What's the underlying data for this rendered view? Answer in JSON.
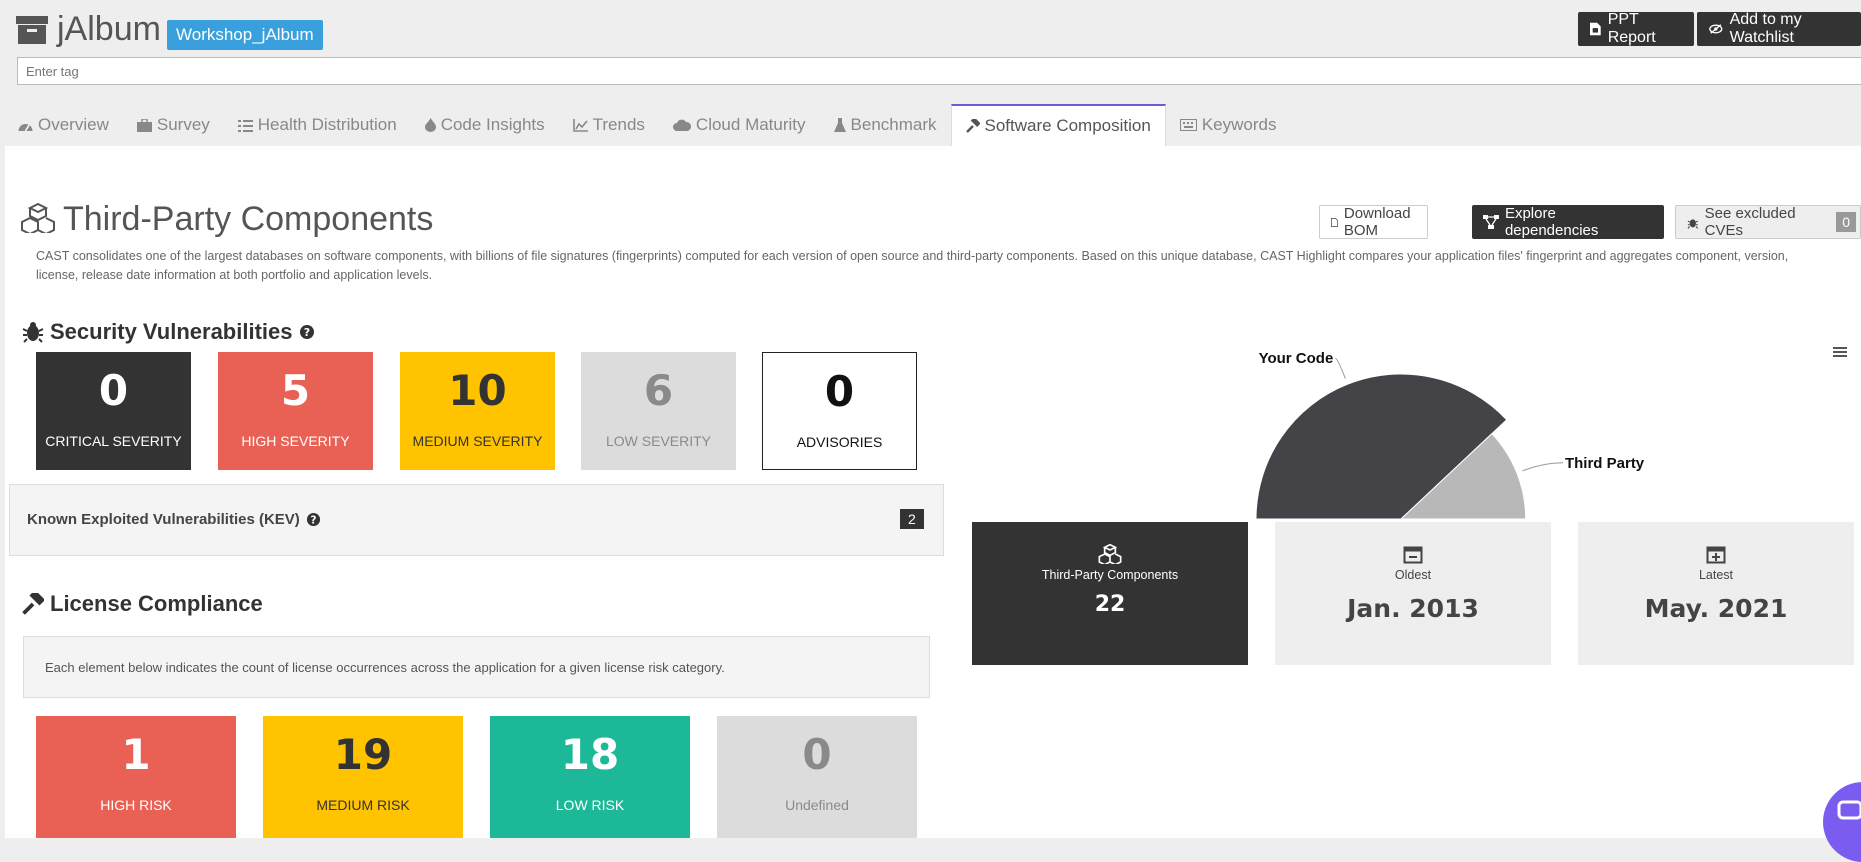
{
  "header": {
    "app_title": "jAlbum",
    "app_tag": "Workshop_jAlbum",
    "ppt_report": "PPT Report",
    "watchlist": "Add to my Watchlist",
    "tag_placeholder": "Enter tag"
  },
  "tabs": [
    {
      "label": "Overview",
      "icon": "dashboard-icon"
    },
    {
      "label": "Survey",
      "icon": "briefcase-icon"
    },
    {
      "label": "Health Distribution",
      "icon": "tasks-icon"
    },
    {
      "label": "Code Insights",
      "icon": "fire-icon"
    },
    {
      "label": "Trends",
      "icon": "line-chart-icon"
    },
    {
      "label": "Cloud Maturity",
      "icon": "cloud-icon"
    },
    {
      "label": "Benchmark",
      "icon": "flask-icon"
    },
    {
      "label": "Software Composition",
      "icon": "gavel-icon",
      "active": true
    },
    {
      "label": "Keywords",
      "icon": "keyboard-icon"
    }
  ],
  "section": {
    "title": "Third-Party Components",
    "description": "CAST consolidates one of the largest databases on software components, with billions of file signatures (fingerprints) computed for each version of open source and third-party components. Based on this unique database, CAST Highlight compares your application files' fingerprint and aggregates component, version, license, release date information at both portfolio and application levels.",
    "download_bom": "Download BOM",
    "explore_dependencies": "Explore dependencies",
    "excluded_cves": "See excluded CVEs",
    "excluded_cves_count": "0"
  },
  "security": {
    "title": "Security Vulnerabilities",
    "boxes": [
      {
        "value": "0",
        "label": "CRITICAL SEVERITY",
        "bg": "#333333",
        "fg": "#ffffff"
      },
      {
        "value": "5",
        "label": "HIGH SEVERITY",
        "bg": "#e96154",
        "fg": "#ffffff"
      },
      {
        "value": "10",
        "label": "MEDIUM SEVERITY",
        "bg": "#ffc300",
        "fg": "#333333"
      },
      {
        "value": "6",
        "label": "LOW SEVERITY",
        "bg": "#dcdcdc",
        "fg": "#8a8a8a"
      },
      {
        "value": "0",
        "label": "ADVISORIES",
        "bg": "#ffffff",
        "fg": "#111111"
      }
    ],
    "kev_label": "Known Exploited Vulnerabilities (KEV)",
    "kev_count": "2"
  },
  "license": {
    "title": "License Compliance",
    "note": "Each element below indicates the count of license occurrences across the application for a given license risk category.",
    "boxes": [
      {
        "value": "1",
        "label": "HIGH RISK",
        "bg": "#e96154",
        "fg": "#ffffff"
      },
      {
        "value": "19",
        "label": "MEDIUM RISK",
        "bg": "#ffc300",
        "fg": "#333333"
      },
      {
        "value": "18",
        "label": "LOW RISK",
        "bg": "#1db897",
        "fg": "#ffffff"
      },
      {
        "value": "0",
        "label": "Undefined",
        "bg": "#dcdcdc",
        "fg": "#8a8a8a"
      }
    ]
  },
  "chart_data": {
    "type": "pie",
    "subtype": "semi-circle",
    "labels": [
      "Your Code",
      "Third Party"
    ],
    "values": [
      76,
      24
    ],
    "colors": [
      "#434348",
      "#b8b8b8"
    ]
  },
  "stats": [
    {
      "label": "Third-Party Components",
      "value": "22",
      "icon": "cubes-icon",
      "bg": "#333333",
      "fg": "#ffffff"
    },
    {
      "label": "Oldest",
      "value": "Jan. 2013",
      "icon": "calendar-minus-icon",
      "bg": "#eeeeee",
      "fg": "#444444"
    },
    {
      "label": "Latest",
      "value": "May. 2021",
      "icon": "calendar-plus-icon",
      "bg": "#eeeeee",
      "fg": "#444444"
    }
  ]
}
